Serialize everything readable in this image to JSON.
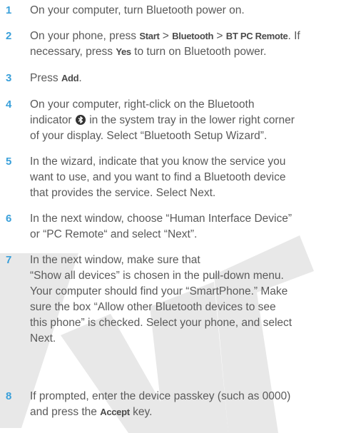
{
  "steps": [
    {
      "number": "1",
      "text": "On your computer, turn Bluetooth power on."
    },
    {
      "number": "2",
      "part1": "On your phone, press ",
      "key1": "Start",
      "sep1": " > ",
      "key2": "Bluetooth",
      "sep2": " > ",
      "key3": "BT PC Remote",
      "part2": ". If",
      "line2a": "necessary, press ",
      "key4": "Yes",
      "line2b": " to turn on Bluetooth power."
    },
    {
      "number": "3",
      "part1": "Press ",
      "key1": "Add",
      "part2": "."
    },
    {
      "number": "4",
      "line1": "On your computer, right-click on the Bluetooth",
      "line2a": "indicator ",
      "icon": "bluetooth-icon",
      "line2b": " in the system tray in the lower right corner",
      "line3": "of your display. Select “Bluetooth Setup Wizard”."
    },
    {
      "number": "5",
      "line1": "In the wizard, indicate that you know the service you",
      "line2": "want to use, and you want to find a Bluetooth device",
      "line3": "that provides the service. Select Next."
    },
    {
      "number": "6",
      "line1": "In the next window, choose “Human Interface Device”",
      "line2": "or “PC Remote“ and select “Next”."
    },
    {
      "number": "7",
      "line1": "In the next window, make sure that",
      "line2": "“Show all devices” is chosen in the pull-down menu.",
      "line3": "Your computer should find your “SmartPhone.” Make",
      "line4": "sure the box “Allow other Bluetooth devices to see",
      "line5": "this phone” is checked. Select your phone, and select",
      "line6": "Next."
    },
    {
      "number": "8",
      "line1": "If prompted, enter the device passkey (such as 0000)",
      "line2a": "and press the ",
      "key1": "Accept",
      "line2b": " key."
    }
  ],
  "colors": {
    "step_number": "#3aa0da",
    "body_text": "#5a5a5a",
    "watermark": "#e2e2e2"
  }
}
